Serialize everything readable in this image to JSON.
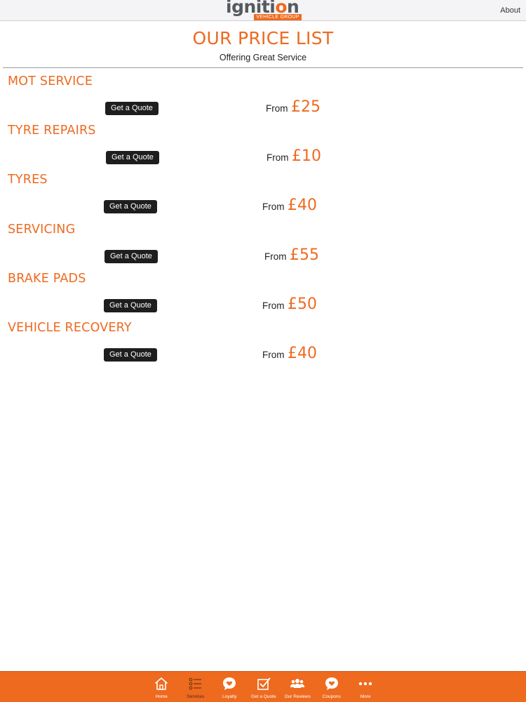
{
  "header": {
    "logo_text_pre": "igniti",
    "logo_text_o": "o",
    "logo_text_post": "n",
    "logo_subtext": "VEHICLE GROUP",
    "about_label": "About"
  },
  "page": {
    "title": "OUR PRICE LIST",
    "subtitle": "Offering Great Service"
  },
  "services": [
    {
      "name": "MOT SERVICE",
      "button_label": "Get a Quote",
      "from_label": "From",
      "price": "£25"
    },
    {
      "name": "TYRE REPAIRS",
      "button_label": "Get a Quote",
      "from_label": "From",
      "price": "£10"
    },
    {
      "name": "TYRES",
      "button_label": "Get a Quote",
      "from_label": "From",
      "price": "£40"
    },
    {
      "name": "SERVICING",
      "button_label": "Get a Quote",
      "from_label": "From",
      "price": "£55"
    },
    {
      "name": "BRAKE PADS",
      "button_label": "Get a Quote",
      "from_label": "From",
      "price": "£50"
    },
    {
      "name": "VEHICLE RECOVERY",
      "button_label": "Get a Quote",
      "from_label": "From",
      "price": "£40"
    }
  ],
  "bottom_nav": {
    "items": [
      {
        "label": "Home",
        "icon": "home-icon"
      },
      {
        "label": "Services",
        "icon": "list-icon",
        "active": true
      },
      {
        "label": "Loyalty",
        "icon": "heart-bubble-icon"
      },
      {
        "label": "Get a Quote",
        "icon": "checkbox-icon"
      },
      {
        "label": "Our Reviews",
        "icon": "people-icon"
      },
      {
        "label": "Coupons",
        "icon": "heart-bubble-icon"
      },
      {
        "label": "More",
        "icon": "more-dots-icon"
      }
    ]
  },
  "colors": {
    "accent": "#ee6a1f",
    "button_bg": "#1e1e1e",
    "topbar_bg": "#f4f4f6"
  }
}
